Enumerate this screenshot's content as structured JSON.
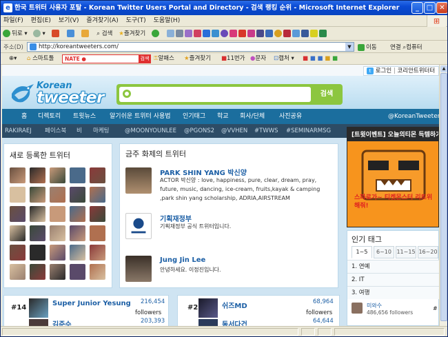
{
  "window": {
    "title": "한국 트위터 사용자 포탈 - Korean Twitter Users Portal and Directory - 검색 랭킹 순위 - Microsoft Internet Explorer",
    "minimize": "_",
    "maximize": "□",
    "close": "✕"
  },
  "menu": [
    "파일(F)",
    "편집(E)",
    "보기(V)",
    "즐겨찾기(A)",
    "도구(T)",
    "도움말(H)"
  ],
  "toolbar": {
    "back": "뒤로",
    "search": "검색",
    "favorites": "즐겨찾기"
  },
  "address": {
    "label": "주소(D)",
    "url": "http://koreantweeters.com/",
    "go": "이동",
    "links": "연결",
    "computer": "컴퓨터"
  },
  "links": {
    "smarttoolbar": "스마트툴",
    "nate": "NATE ●",
    "nate_btn": "검색",
    "alarm": "알패스",
    "fav": "즐겨찾기",
    "eleven": "11번가",
    "text": "문자",
    "capture": "캡처"
  },
  "site": {
    "login": "로그인",
    "brand_short": "코리안트위터터",
    "logo_top": "Korean",
    "logo_main": "tweeter",
    "search_btn": "검색",
    "nav": [
      "홈",
      "디렉토리",
      "트윗뉴스",
      "알기쉬운 트위터 사용법",
      "인기태그",
      "학교",
      "회사/단체",
      "사진공유"
    ],
    "nav_account": "@KoreanTweeters",
    "tags": [
      "RAKIRAEJ",
      "페이스북",
      "비",
      "마케팅",
      "@MOONYOUNLEE",
      "@PGONS2",
      "@VVHEN",
      "#TWWS",
      "#SEMINARMSG"
    ],
    "new_title": "새로 등록한 트위터",
    "hot_title": "금주 화제의 트위터",
    "hot": [
      {
        "name": "PARK SHIN YANG 박신양",
        "desc": "ACTOR 박신양 : love, happiness, pure, clear, dream, pray, future, music, dancing, ice-cream, fruits,kayak & camping ,park shin yang scholarship, ADRIA,AIRSTREAM"
      },
      {
        "name": "기획재정부",
        "desc": "기획재정부 공식 트위터입니다."
      },
      {
        "name": "Jung Jin Lee",
        "desc": "안녕하세요. 이정진입니다."
      }
    ],
    "promo_title": "[트윗이벤트] 오늘의티몬 득템하기!",
    "promo_caption": "스파로가~ 티켓몬스터 리트위 해줘!",
    "popular_title": "인기 태그",
    "tabs": [
      "1~5",
      "6~10",
      "11~15",
      "16~20"
    ],
    "popular_tags": [
      "1. 연예",
      "2. IT",
      "3. 여행"
    ],
    "popular_user": {
      "name": "미와수",
      "followers": "486,656 followers"
    },
    "rank_left": [
      {
        "rank": "#14",
        "name": "Super Junior Yesung",
        "count": "216,454",
        "unit": "followers"
      },
      {
        "rank": "",
        "name": "김준수",
        "count": "203,393",
        "unit": ""
      }
    ],
    "rank_right": [
      {
        "rank": "#2",
        "name": "쉬즈MD",
        "count": "68,964",
        "unit": "followers"
      },
      {
        "rank": "",
        "name": "동서다건",
        "count": "64,644",
        "unit": ""
      }
    ]
  },
  "colors": {
    "nav": "#1b6e9e",
    "accent_green": "#8cc63f",
    "link_blue": "#1c5fa5"
  }
}
